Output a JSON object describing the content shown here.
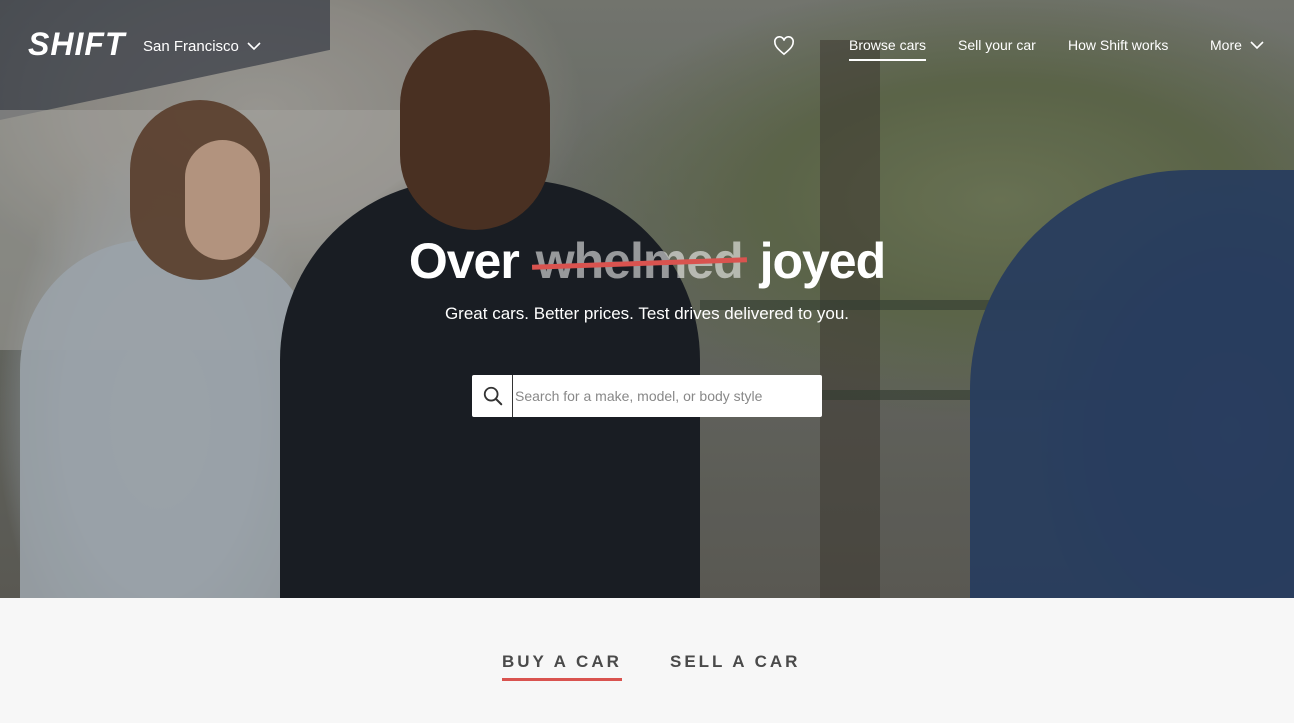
{
  "header": {
    "logo": "SHIFT",
    "city": "San Francisco",
    "nav": {
      "browse": "Browse cars",
      "sell": "Sell your car",
      "how": "How Shift works",
      "more": "More"
    }
  },
  "hero": {
    "headline_prefix": "Over",
    "headline_struck": "whelmed",
    "headline_suffix": "joyed",
    "subheadline": "Great cars. Better prices. Test drives delivered to you.",
    "search_placeholder": "Search for a make, model, or body style",
    "search_value": ""
  },
  "tabs": {
    "buy": "BUY A CAR",
    "sell": "SELL A CAR",
    "active": "buy"
  },
  "colors": {
    "accent": "#d9534f",
    "text_dark": "#4a4a4a",
    "white": "#ffffff"
  },
  "icons": [
    "heart-icon",
    "search-icon",
    "chevron-down-icon"
  ]
}
